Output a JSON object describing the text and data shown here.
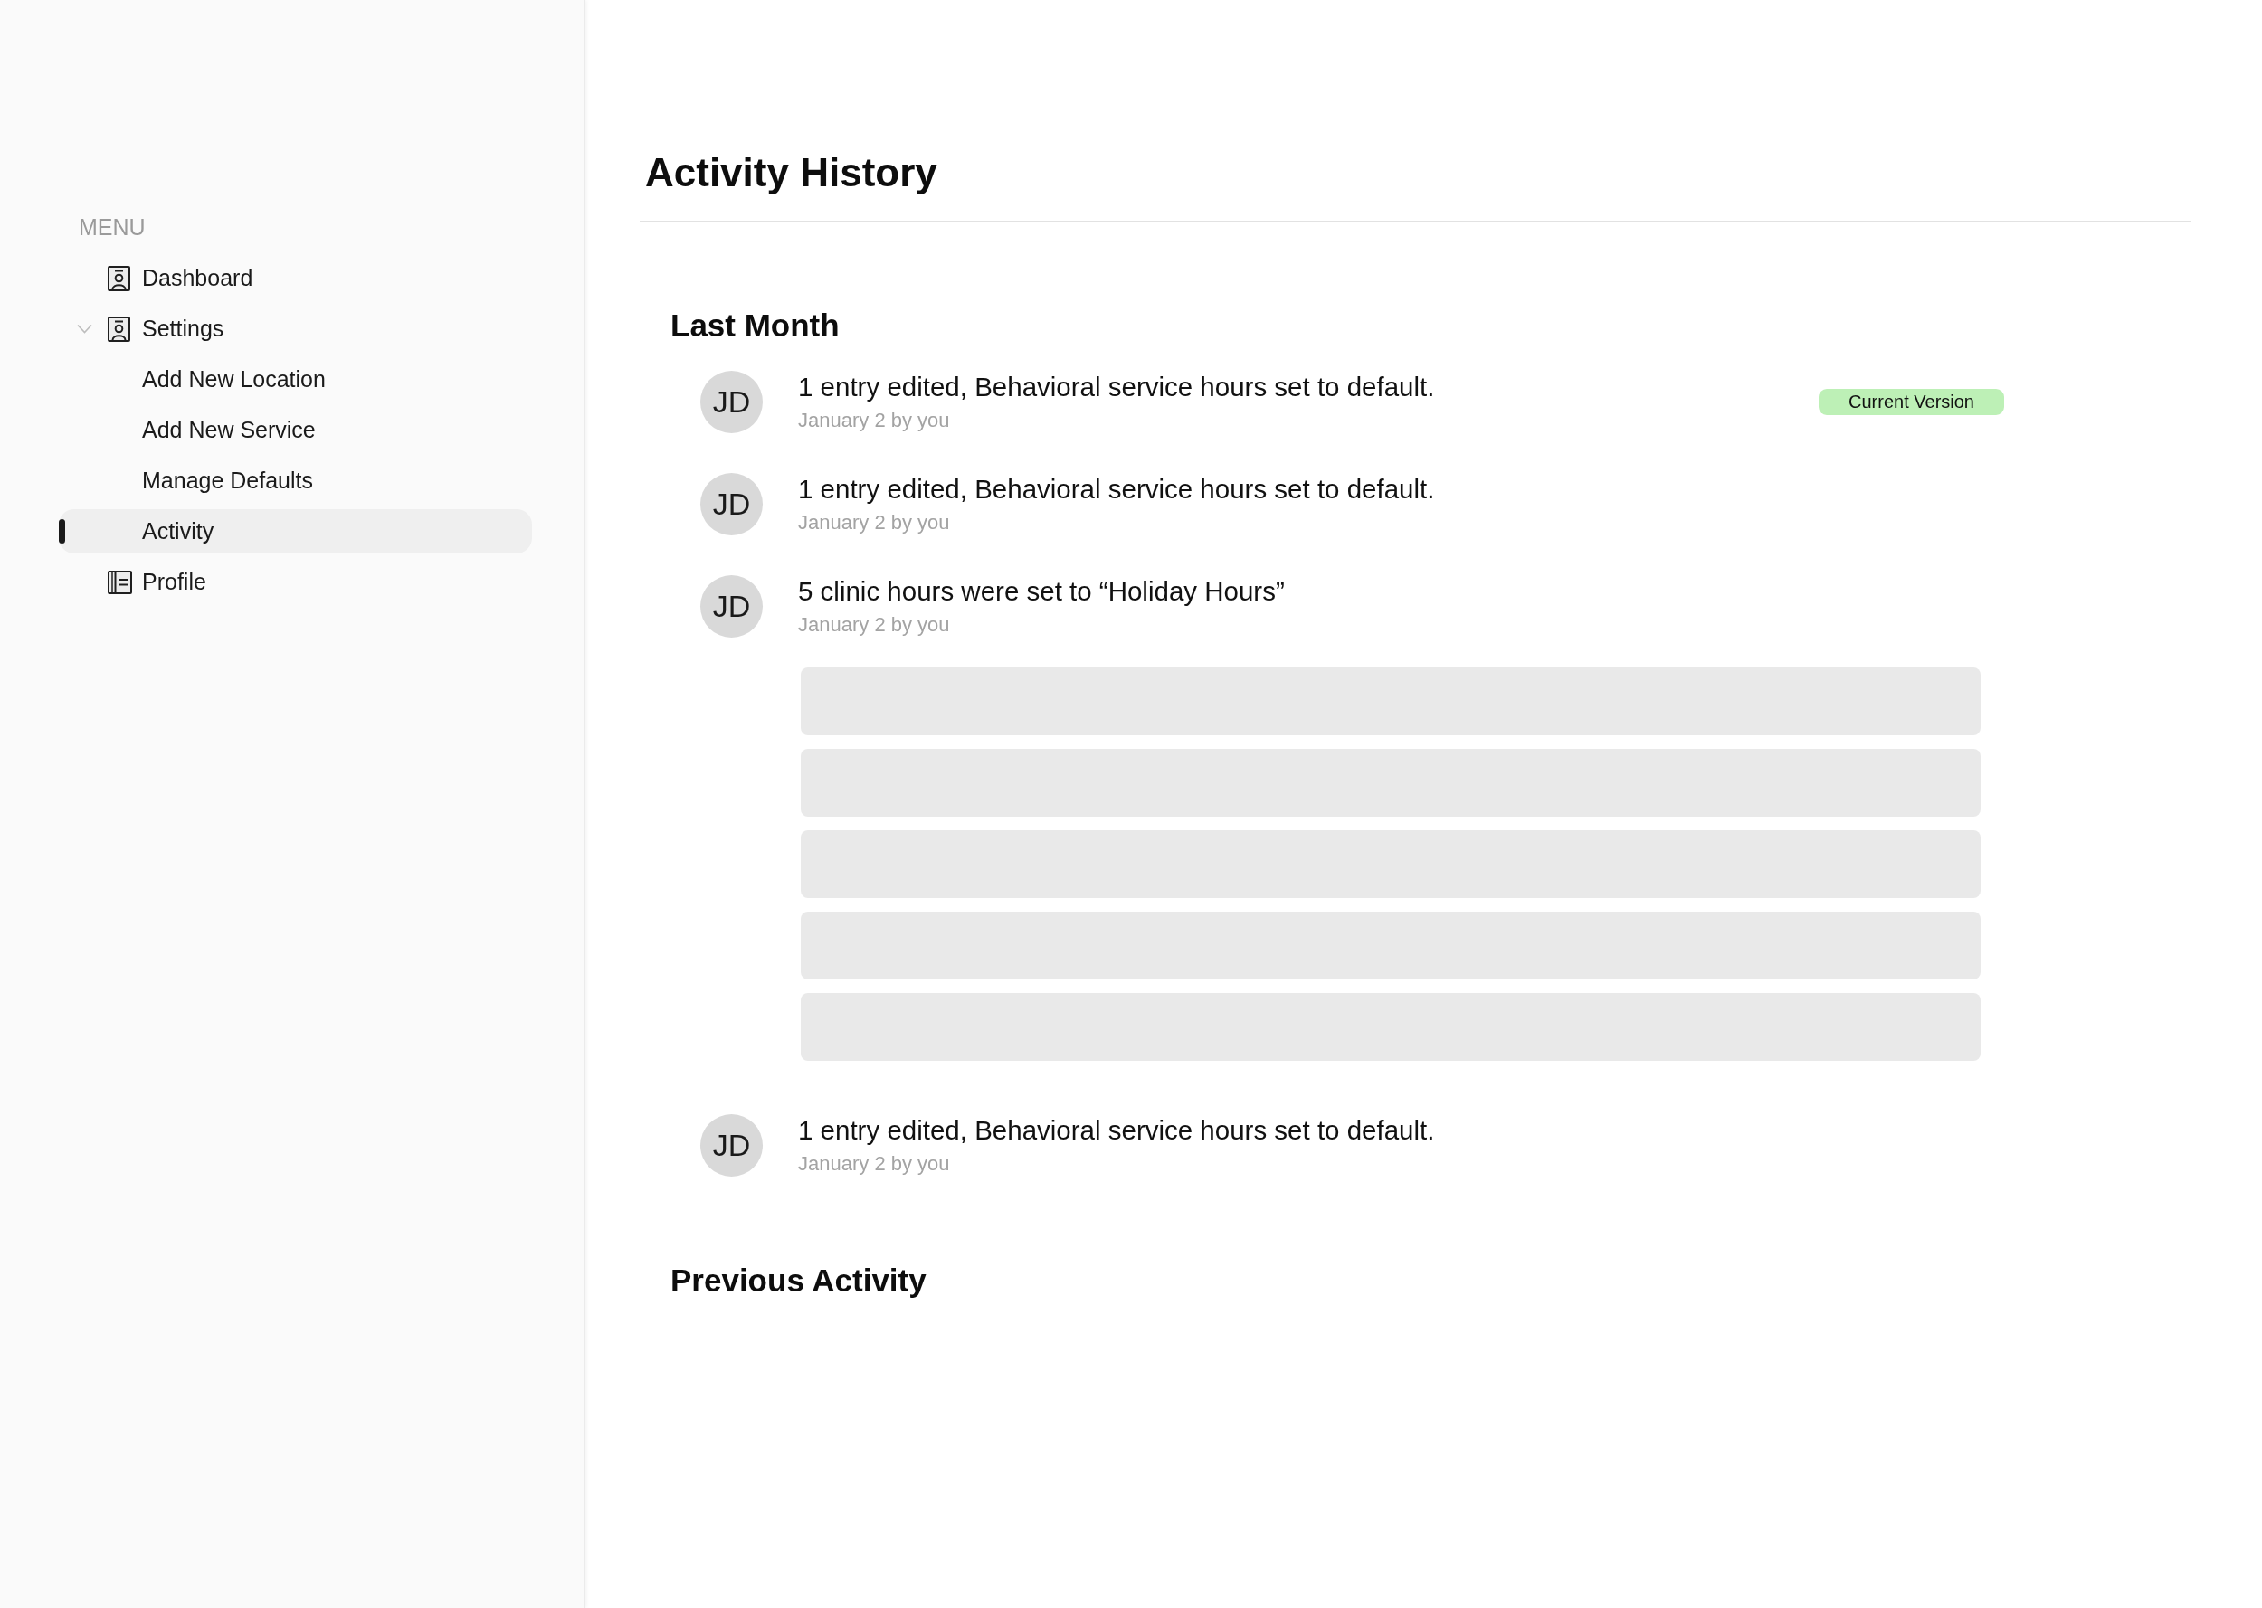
{
  "sidebar": {
    "heading": "MENU",
    "items": [
      {
        "label": "Dashboard",
        "kind": "link",
        "selected": false
      },
      {
        "label": "Settings",
        "kind": "group",
        "selected": false,
        "expanded": true,
        "children": [
          {
            "label": "Add New Location",
            "selected": false
          },
          {
            "label": "Add New Service",
            "selected": false
          },
          {
            "label": "Manage Defaults",
            "selected": false
          },
          {
            "label": "Activity",
            "selected": true
          }
        ]
      },
      {
        "label": "Profile",
        "kind": "page",
        "selected": false
      }
    ]
  },
  "page": {
    "title": "Activity History",
    "sections": [
      {
        "heading": "Last Month",
        "entries": [
          {
            "initials": "JD",
            "summary": "1 entry edited, Behavioral service hours set to default.",
            "meta": "January 2 by you",
            "tag": "Current Version"
          },
          {
            "initials": "JD",
            "summary": "1 entry edited, Behavioral service hours set to default.",
            "meta": "January 2 by you"
          },
          {
            "initials": "JD",
            "summary": "5 clinic hours were set to “Holiday Hours”",
            "meta": "January 2 by you",
            "details": [
              {
                "kind": "placeholder"
              },
              {
                "kind": "placeholder"
              },
              {
                "kind": "placeholder"
              },
              {
                "kind": "placeholder"
              },
              {
                "kind": "placeholder"
              }
            ]
          },
          {
            "initials": "JD",
            "summary": "1 entry edited, Behavioral service hours set to default.",
            "meta": "January 2 by you"
          }
        ]
      },
      {
        "heading": "Previous Activity"
      }
    ]
  }
}
